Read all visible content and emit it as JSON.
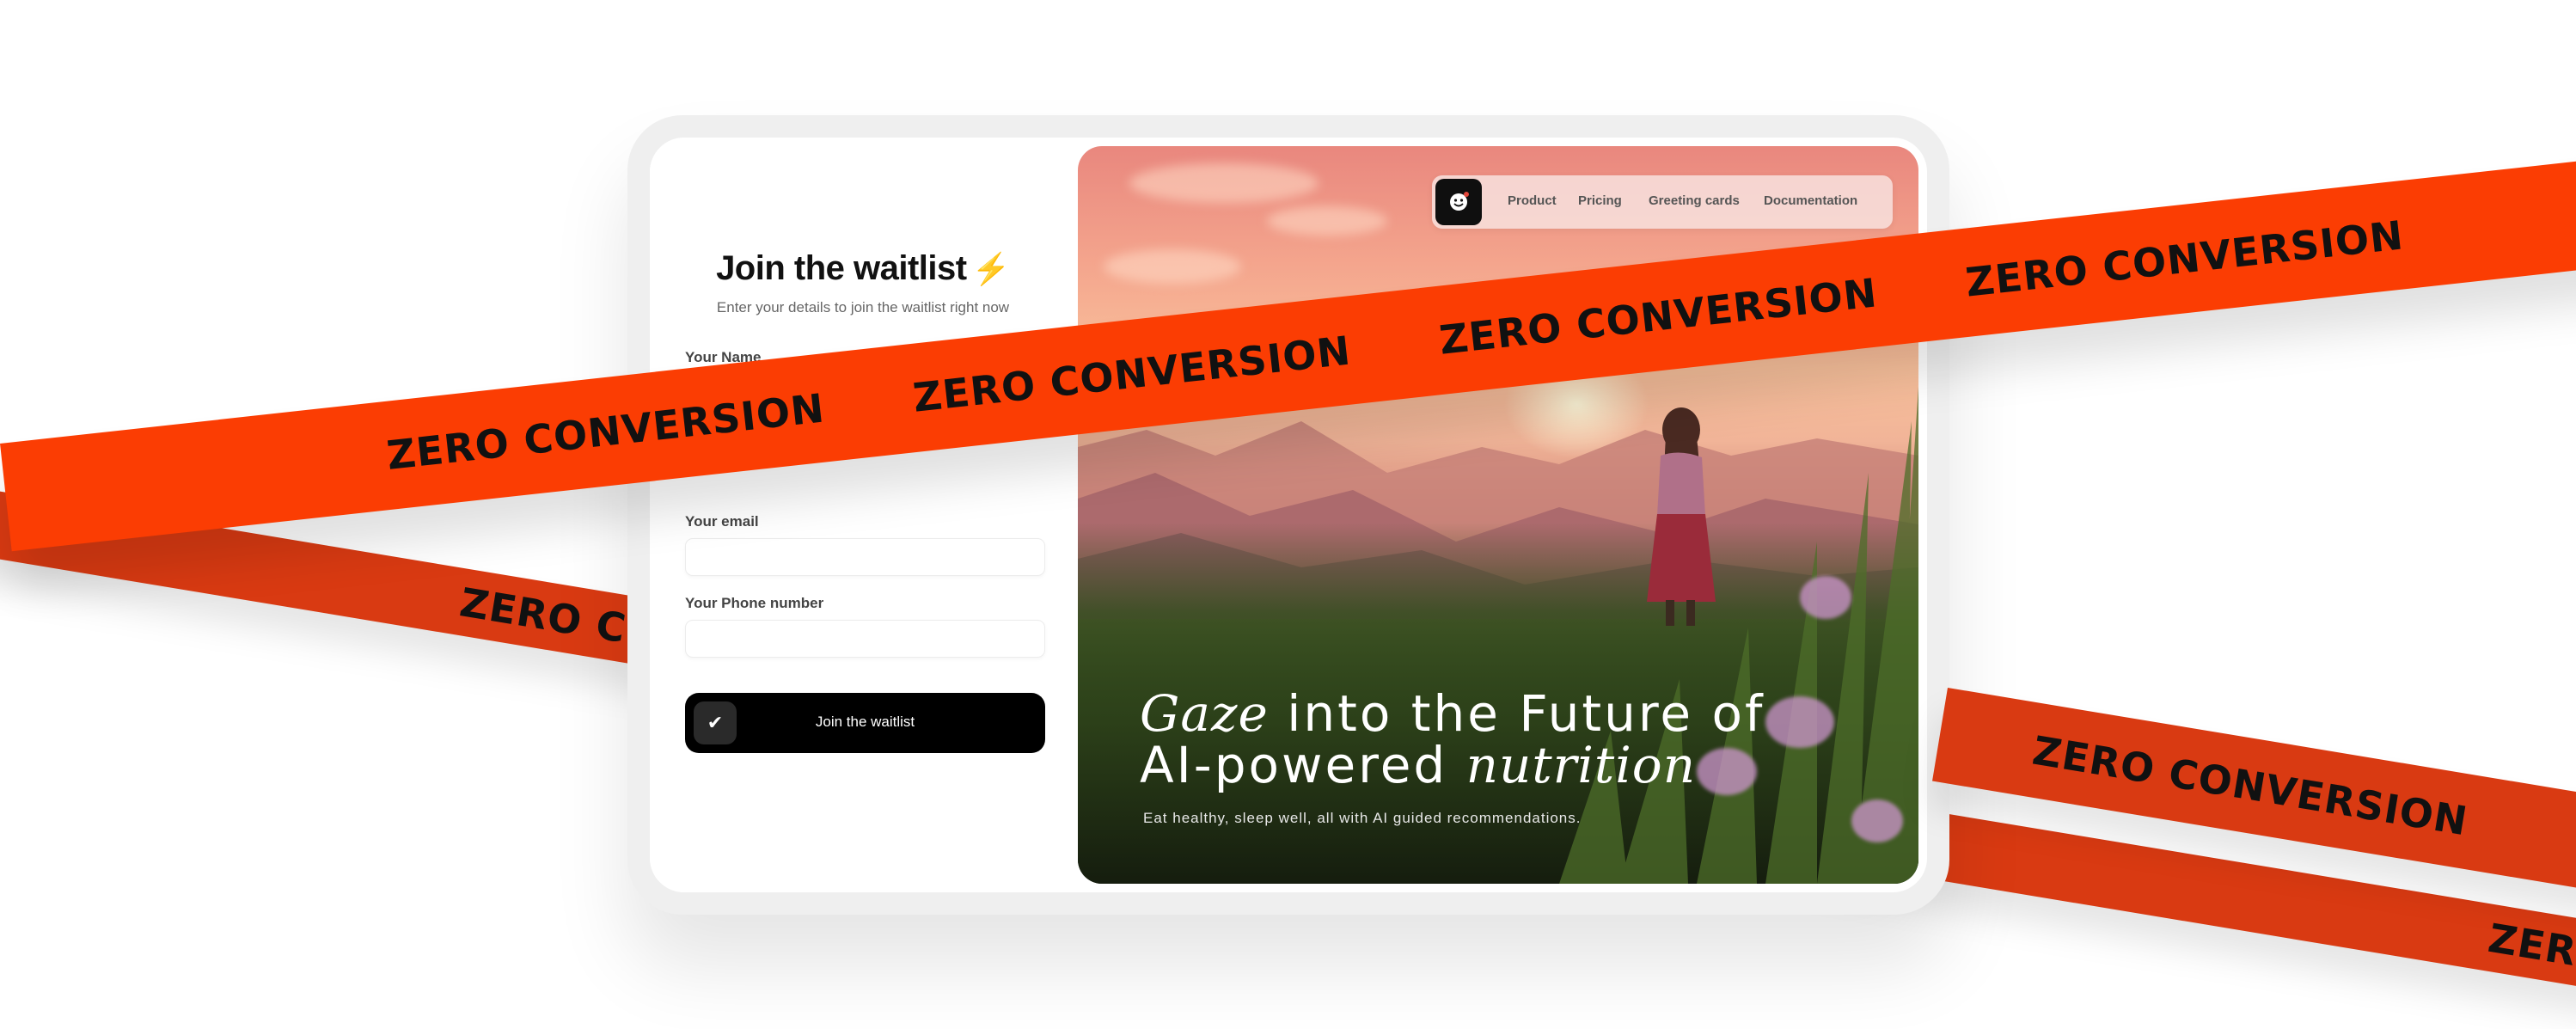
{
  "banner": {
    "text": "ZERO CONVERSION",
    "front_color": "#fb3d03",
    "back_color": "#d93a12"
  },
  "form": {
    "title": "Join the waitlist",
    "title_icon": "lightning-bolt-icon",
    "subtitle": "Enter your details to join the waitlist right now",
    "name_label": "Your Name",
    "name_value": "",
    "email_label": "Your email",
    "email_value": "",
    "phone_label": "Your Phone number",
    "phone_value": "",
    "submit_label": "Join the waitlist",
    "submit_icon": "checkmark-icon"
  },
  "nav": {
    "logo_icon": "smiley-face-icon",
    "items": [
      "Product",
      "Pricing",
      "Greeting cards",
      "Documentation"
    ]
  },
  "hero": {
    "heading_line1_italic": "Gaze",
    "heading_line1_rest": " into the Future of",
    "heading_line2_plain": "AI-powered ",
    "heading_line2_italic": "nutrition",
    "subheading": "Eat healthy, sleep well, all with AI guided recommendations."
  }
}
